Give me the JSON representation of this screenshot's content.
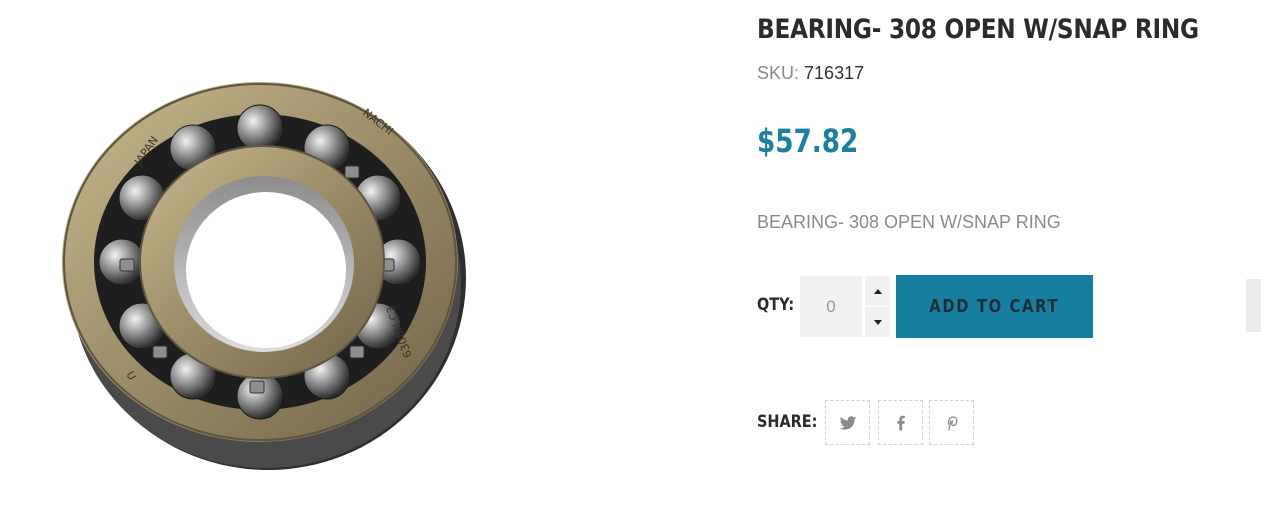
{
  "product": {
    "title": "BEARING- 308 OPEN W/SNAP RING",
    "sku_label": "SKU:",
    "sku_value": "716317",
    "price": "$57.82",
    "description": "BEARING- 308 OPEN W/SNAP RING",
    "image_text": {
      "brand": "NACHI",
      "origin": "JAPAN",
      "model": "6308N C3",
      "mark": "U"
    }
  },
  "purchase": {
    "qty_label": "QTY:",
    "qty_value": "0",
    "add_to_cart_label": "ADD TO CART"
  },
  "share": {
    "label": "SHARE:",
    "buttons": [
      "twitter-icon",
      "facebook-icon",
      "pinterest-icon"
    ]
  },
  "colors": {
    "accent": "#167fa0",
    "price": "#1b7fa0",
    "muted_text": "#8a8a8a",
    "heading": "#2b2b2b"
  }
}
